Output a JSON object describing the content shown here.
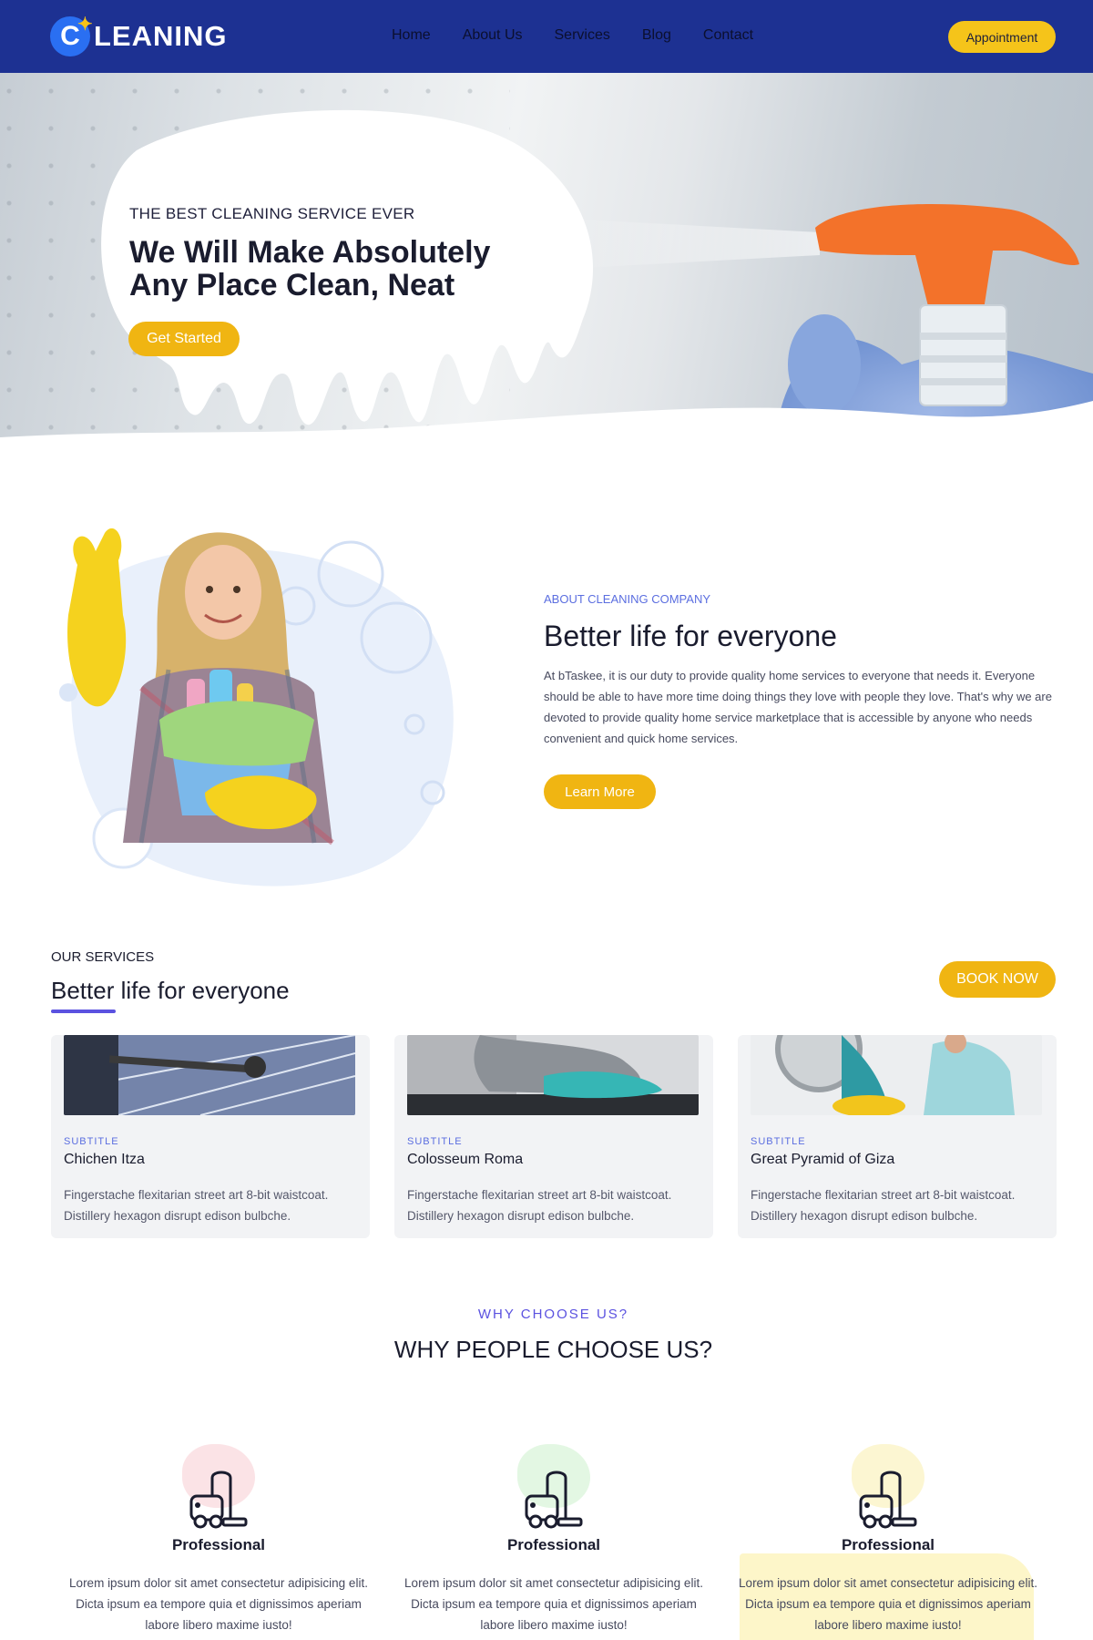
{
  "brand": {
    "logo_letter": "C",
    "logo_text": "LEANING"
  },
  "nav": {
    "items": [
      "Home",
      "About Us",
      "Services",
      "Blog",
      "Contact"
    ],
    "cta_label": "Appointment"
  },
  "hero": {
    "kicker": "THE BEST CLEANING SERVICE EVER",
    "title": "We Will Make Absolutely Any Place Clean, Neat",
    "cta_label": "Get Started"
  },
  "about": {
    "kicker": "ABOUT CLEANING COMPANY",
    "title": "Better life for everyone",
    "body": "At bTaskee, it is our duty to provide quality home services to everyone that needs it. Everyone should be able to have more time doing things they love with people they love. That's why we are devoted to provide quality home service marketplace that is accessible by anyone who needs convenient and quick home services.",
    "cta_label": "Learn More"
  },
  "services": {
    "kicker": "OUR SERVICES",
    "title": "Better life for everyone",
    "cta_label": "BOOK NOW",
    "cards": [
      {
        "subtitle": "SUBTITLE",
        "title": "Chichen Itza",
        "text": "Fingerstache flexitarian street art 8-bit waistcoat. Distillery hexagon disrupt edison bulbche."
      },
      {
        "subtitle": "SUBTITLE",
        "title": "Colosseum Roma",
        "text": "Fingerstache flexitarian street art 8-bit waistcoat. Distillery hexagon disrupt edison bulbche."
      },
      {
        "subtitle": "SUBTITLE",
        "title": "Great Pyramid of Giza",
        "text": "Fingerstache flexitarian street art 8-bit waistcoat. Distillery hexagon disrupt edison bulbche."
      }
    ]
  },
  "why": {
    "kicker": "WHY CHOOSE US?",
    "title": "WHY PEOPLE CHOOSE US?",
    "features": [
      {
        "title": "Professional",
        "text": "Lorem ipsum dolor sit amet consectetur adipisicing elit. Dicta ipsum ea tempore quia et dignissimos aperiam labore libero maxime iusto!",
        "icon": "vacuum-cleaner-icon",
        "accent": "#fbe3e6"
      },
      {
        "title": "Professional",
        "text": "Lorem ipsum dolor sit amet consectetur adipisicing elit. Dicta ipsum ea tempore quia et dignissimos aperiam labore libero maxime iusto!",
        "icon": "vacuum-cleaner-icon",
        "accent": "#e3f7e3"
      },
      {
        "title": "Professional",
        "text": "Lorem ipsum dolor sit amet consectetur adipisicing elit. Dicta ipsum ea tempore quia et dignissimos aperiam labore libero maxime iusto!",
        "icon": "vacuum-cleaner-icon",
        "accent": "#fcf6d2"
      }
    ]
  },
  "colors": {
    "nav_bg": "#1d3192",
    "accent_yellow": "#f0b512",
    "accent_purple": "#5b52e0"
  }
}
